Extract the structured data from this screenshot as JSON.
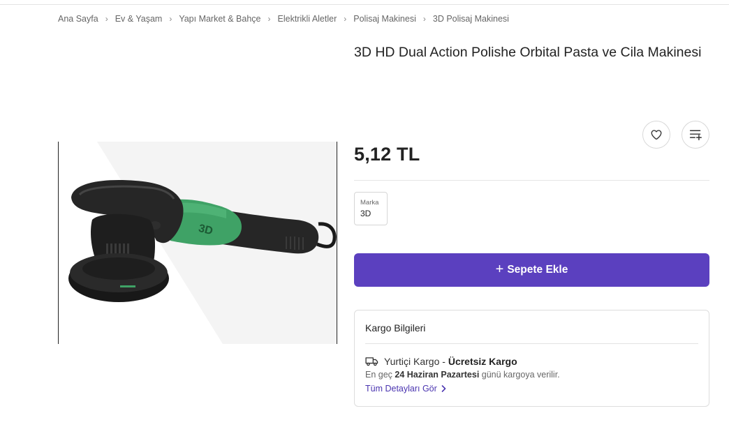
{
  "breadcrumb": [
    "Ana Sayfa",
    "Ev & Yaşam",
    "Yapı Market & Bahçe",
    "Elektrikli Aletler",
    "Polisaj Makinesi",
    "3D Polisaj Makinesi"
  ],
  "product": {
    "title": "3D HD Dual Action Polishe Orbital Pasta ve Cila Makinesi",
    "price": "5,12 TL",
    "image_logo": "3D",
    "brand": {
      "label": "Marka",
      "value": "3D"
    }
  },
  "actions": {
    "favorite_icon": "heart-icon",
    "add_to_list_icon": "playlist-add-icon",
    "add_to_cart": "Sepete Ekle"
  },
  "cargo": {
    "title": "Kargo Bilgileri",
    "type_label": "Yurtiçi Kargo",
    "dash": " - ",
    "type_value": "Ücretsiz Kargo",
    "date_prefix": "En geç ",
    "date_value": "24 Haziran Pazartesi",
    "date_suffix": " günü kargoya verilir.",
    "details_link": "Tüm Detayları Gör"
  },
  "colors": {
    "accent": "#5b40bf",
    "link": "#4a34b0"
  }
}
